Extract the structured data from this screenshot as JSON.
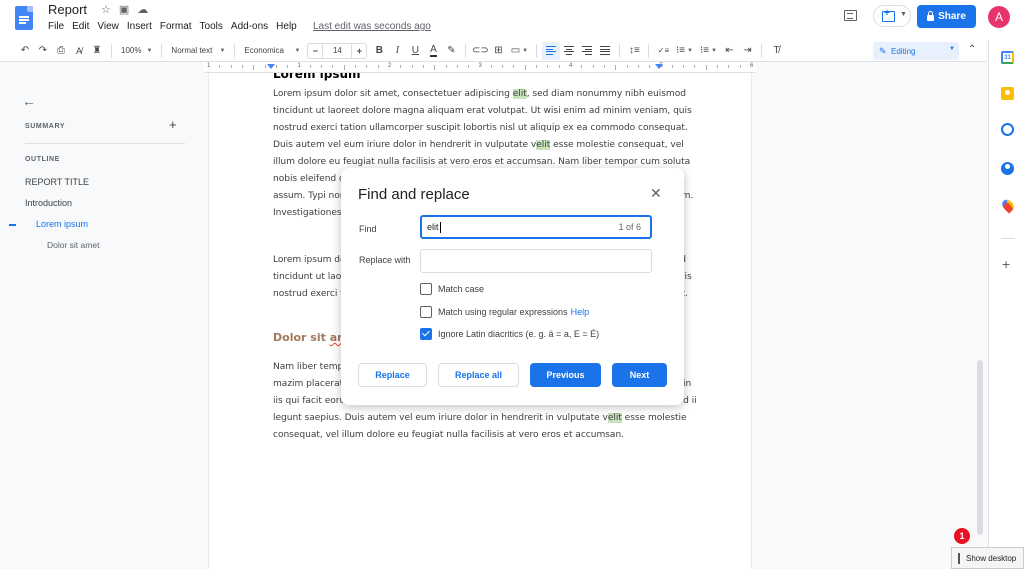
{
  "app": {
    "doc_title": "Report",
    "menu": [
      "File",
      "Edit",
      "View",
      "Insert",
      "Format",
      "Tools",
      "Add-ons",
      "Help"
    ],
    "last_edit": "Last edit was seconds ago",
    "share_label": "Share",
    "avatar_initial": "A",
    "brand_color": "#1a73e8",
    "avatar_color": "#e8336b"
  },
  "toolbar": {
    "zoom": "100%",
    "style": "Normal text",
    "font": "Economica",
    "font_size": "14",
    "minus": "−",
    "plus": "+",
    "mode": "Editing"
  },
  "ruler": {
    "labels": [
      "1",
      "1",
      "2",
      "3",
      "4",
      "5",
      "6",
      "7"
    ]
  },
  "outline": {
    "summary_label": "SUMMARY",
    "outline_label": "OUTLINE",
    "items": [
      {
        "label": "REPORT TITLE",
        "level": 0,
        "active": false
      },
      {
        "label": "Introduction",
        "level": 0,
        "active": false
      },
      {
        "label": "Lorem ipsum",
        "level": 1,
        "active": true
      },
      {
        "label": "Dolor sit amet",
        "level": 2,
        "active": false
      }
    ]
  },
  "document": {
    "heading1": "Lorem ipsum",
    "p1": {
      "a": "Lorem ipsum dolor sit amet, consectetuer adipiscing ",
      "hl1": "elit",
      "b": ", sed diam nonummy nibh euismod tincidunt ut laoreet dolore magna aliquam erat volutpat. Ut wisi enim ad minim veniam, quis nostrud exerci tation ullamcorper suscipit lobortis nisl ut aliquip ex ea commodo consequat. Duis autem vel eum iriure dolor in hendrerit in vulputate v",
      "hl2": "elit",
      "c": " esse molestie consequat, vel illum dolore eu feugiat nulla facilisis at vero eros et accumsan. Nam liber tempor cum soluta nobis eleifend option congue nihil imperdiet doming id quod mazim placerat facer possim assum. Typi non habent claritatem insitam; est usus legentis in iis qui facit eorum claritatem. Investigationes demonstraverunt lectores legere me lius quod ii legunt saepius."
    },
    "p2": "Lorem ipsum dolor sit amet, consectetuer adipiscing elit, sed diam nonummy nibh euismod tincidunt ut laoreet dolore magna aliquam erat volutpat. Ut wisi enim ad minim veniam, quis nostrud exerci tation ullamcorper suscipit lobortis nisl ut aliquip ex ea commodo consequat.",
    "heading2_a": "Dolor sit ",
    "heading2_b": "amet",
    "p3": {
      "a": "Nam liber tempor cum soluta nobis eleifend option congue nihil imperdiet doming id quod mazim placerat facer possim assum. Typi non habent claritatem insitam; est usus legentis in iis qui facit eorum claritatem. Investigationes demonstraverunt lectores legere me lius quod ii legunt saepius. Duis autem vel eum iriure dolor in hendrerit in vulputate v",
      "hl": "elit",
      "b": " esse molestie consequat, vel illum dolore eu feugiat nulla facilisis at vero eros et accumsan."
    },
    "highlight_color": "#c6e2b9"
  },
  "dialog": {
    "title": "Find and replace",
    "find_label": "Find",
    "find_value": "elit",
    "match_count": "1 of 6",
    "replace_label": "Replace with",
    "replace_value": "",
    "options": [
      {
        "label": "Match case",
        "checked": false
      },
      {
        "label": "Match using regular expressions",
        "checked": false,
        "link": "Help"
      },
      {
        "label": "Ignore Latin diacritics (e. g. ä = a, E = É)",
        "checked": true
      }
    ],
    "buttons": {
      "replace": "Replace",
      "replace_all": "Replace all",
      "previous": "Previous",
      "next": "Next"
    }
  },
  "taskbar": {
    "notification_count": "1",
    "show_desktop": "Show desktop"
  }
}
